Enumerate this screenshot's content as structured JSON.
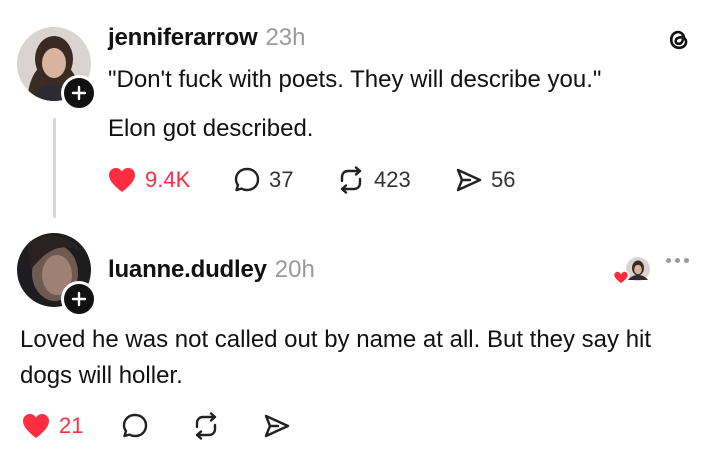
{
  "posts": [
    {
      "username": "jenniferarrow",
      "time": "23h",
      "lines": [
        "\"Don't fuck with poets. They will describe you.\"",
        "Elon got described."
      ],
      "likes": "9.4K",
      "replies": "37",
      "reposts": "423",
      "shares": "56"
    },
    {
      "username": "luanne.dudley",
      "time": "20h",
      "text": "Loved he was not called out by name at all.  But they say hit dogs will holler.",
      "likes": "21"
    }
  ],
  "colors": {
    "like": "#ff2d3f",
    "muted": "#9a9a9a",
    "text": "#111111"
  },
  "icons": [
    "threads-logo-icon",
    "plus-icon",
    "heart-icon",
    "comment-icon",
    "repost-icon",
    "share-icon",
    "more-icon"
  ]
}
